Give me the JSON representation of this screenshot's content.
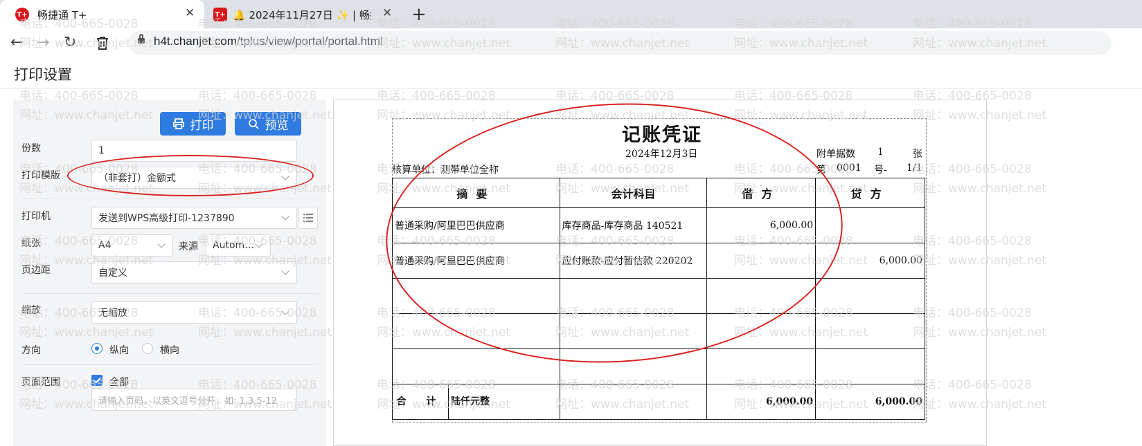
{
  "browser": {
    "tabs": [
      {
        "favicon": "T+",
        "title": "畅捷通 T+"
      },
      {
        "favicon": "T+",
        "title": "🔔 2024年11月27日 ✨ | 畅捷通"
      }
    ],
    "new_tab": "+",
    "url_host": "h4t.chanjet.com",
    "url_path": "/tplus/view/portal/portal.html"
  },
  "page": {
    "title": "打印设置",
    "print_label": "打印",
    "preview_label": "预览"
  },
  "settings": {
    "copies": {
      "label": "份数",
      "value": "1"
    },
    "template": {
      "label": "打印模版",
      "value": "（非套打）金额式"
    },
    "printer": {
      "label": "打印机",
      "value": "发送到WPS高级打印-1237890"
    },
    "paper": {
      "label": "纸张",
      "value": "A4",
      "source_label": "来源",
      "source_value": "Autom…"
    },
    "margin": {
      "label": "页边距",
      "value": "自定义"
    },
    "scale": {
      "label": "缩放",
      "value": "无缩放"
    },
    "orientation": {
      "label": "方向",
      "portrait": "纵向",
      "landscape": "横向",
      "selected": "portrait"
    },
    "range": {
      "label": "页面范围",
      "all": "全部",
      "placeholder": "请输入页码，以英文逗号分开，如: 1,3,5-12"
    }
  },
  "voucher": {
    "title": "记账凭证",
    "date": "2024年12月3日",
    "attach_label": "附单据数",
    "attach_count": "1",
    "attach_unit": "张",
    "unit": "核算单位：测帯单位全称",
    "no_label": "第",
    "no": "0001",
    "no_suffix": "号-",
    "page": "1/1",
    "headers": [
      "摘要",
      "会计科目",
      "借方",
      "贷方"
    ],
    "rows": [
      {
        "summary": "普通采购/阿里巴巴供应商",
        "account": "库存商品-库存商品 140521",
        "debit": "6,000.00",
        "credit": ""
      },
      {
        "summary": "普通采购/阿里巴巴供应商",
        "account": "应付账款-应付暂估款 220202",
        "debit": "",
        "credit": "6,000.00"
      }
    ],
    "total_label": "合 计",
    "total_words": "陆仟元整",
    "total_debit": "6,000.00",
    "total_credit": "6,000.00"
  },
  "watermark": {
    "phone": "电话：400-665-0028",
    "site": "网址：www.chanjet.net"
  }
}
